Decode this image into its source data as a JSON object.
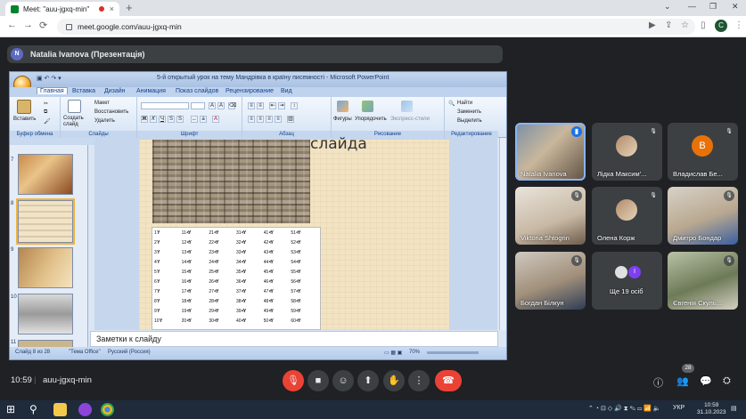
{
  "browser": {
    "tab_title": "Meet: \"auu-jgxq-min\"",
    "tab_close": "×",
    "new_tab": "+",
    "url": "meet.google.com/auu-jgxq-min",
    "profile_initial": "C"
  },
  "presentation_banner": {
    "presenter_initial": "N",
    "text": "Natalia Ivanova (Презентація)"
  },
  "powerpoint": {
    "window_title": "5-й открытый урок на тему Мандрівка в країну писемності - Microsoft PowerPoint",
    "tabs": [
      "Главная",
      "Вставка",
      "Дизайн",
      "Анимация",
      "Показ слайдов",
      "Рецензирование",
      "Вид"
    ],
    "ribbon": {
      "paste": "Вставить",
      "create_slide": "Создать слайд",
      "layout": "Макет",
      "restore": "Восстановить",
      "delete": "Удалить",
      "figures": "Фигуры",
      "arrange": "Упорядочить",
      "express_styles": "Экспресс-стили",
      "find": "Найти",
      "replace": "Заменить",
      "select": "Выделить",
      "group_clipboard": "Буфер обмена",
      "group_slides": "Слайды",
      "group_font": "Шрифт",
      "group_paragraph": "Абзац",
      "group_drawing": "Рисование",
      "group_editing": "Редактирование"
    },
    "slide_numbers": [
      "7",
      "8",
      "9",
      "10",
      "11"
    ],
    "slide_title_partial": "слайда",
    "number_table": [
      [
        "1",
        "11",
        "21",
        "31",
        "41",
        "51"
      ],
      [
        "2",
        "12",
        "22",
        "32",
        "42",
        "52"
      ],
      [
        "3",
        "13",
        "23",
        "33",
        "43",
        "53"
      ],
      [
        "4",
        "14",
        "24",
        "34",
        "44",
        "54"
      ],
      [
        "5",
        "15",
        "25",
        "35",
        "45",
        "55"
      ],
      [
        "6",
        "16",
        "26",
        "36",
        "46",
        "56"
      ],
      [
        "7",
        "17",
        "27",
        "37",
        "47",
        "57"
      ],
      [
        "8",
        "18",
        "28",
        "38",
        "48",
        "58"
      ],
      [
        "9",
        "19",
        "29",
        "39",
        "49",
        "59"
      ],
      [
        "10",
        "20",
        "30",
        "40",
        "50",
        "60"
      ]
    ],
    "notes_placeholder": "Заметки к слайду",
    "status": {
      "slide_count": "Слайд 8 из 28",
      "theme": "\"Тема Office\"",
      "language": "Русский (Россия)",
      "zoom": "70%"
    }
  },
  "participants": [
    {
      "name": "Natalia Ivanova",
      "type": "video",
      "speaking": true
    },
    {
      "name": "Лідка Максим'...",
      "type": "photo",
      "muted": true
    },
    {
      "name": "Владислав Бе...",
      "type": "avatar",
      "initial": "B",
      "color": "#e8710a",
      "muted": true
    },
    {
      "name": "Viktoria Shtogrin",
      "type": "video",
      "muted": true
    },
    {
      "name": "Олена Корж",
      "type": "photo",
      "muted": true
    },
    {
      "name": "Дмитро Бондар",
      "type": "video",
      "muted": true
    },
    {
      "name": "Богдан Білкун",
      "type": "video",
      "muted": true
    },
    {
      "name": "Ще 19 осіб",
      "type": "others",
      "initial": "I"
    },
    {
      "name": "Євгенія Скуль...",
      "type": "video",
      "muted": true
    }
  ],
  "meeting_bar": {
    "time": "10:59",
    "code": "auu-jgxq-min",
    "people_count": "28"
  },
  "taskbar": {
    "language": "УКР",
    "time": "10:59",
    "date": "31.10.2023"
  },
  "colors": {
    "meet_bg": "#202124",
    "end_call": "#ea4335",
    "office_blue": "#15428b"
  }
}
